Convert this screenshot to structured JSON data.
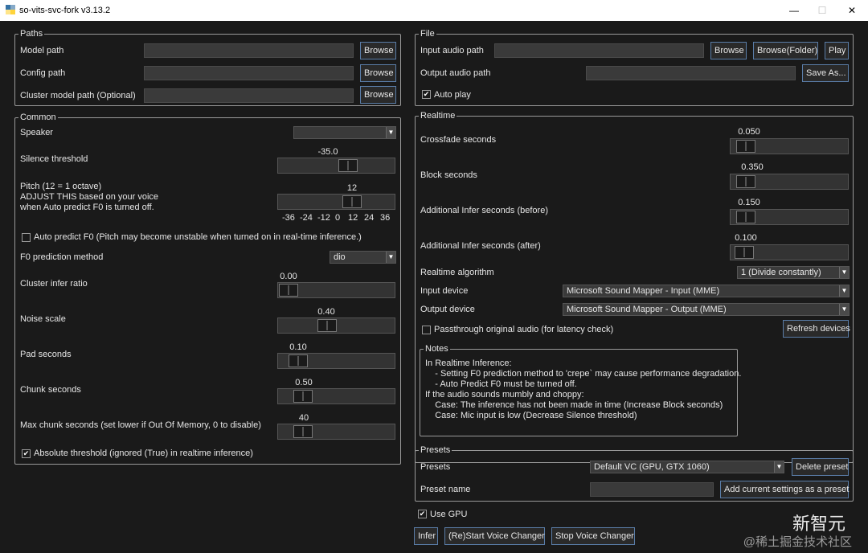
{
  "window": {
    "title": "so-vits-svc-fork v3.13.2",
    "min": "—",
    "max": "☐",
    "close": "✕"
  },
  "paths": {
    "legend": "Paths",
    "model_label": "Model path",
    "config_label": "Config path",
    "cluster_label": "Cluster model path (Optional)",
    "model_value": "",
    "config_value": "",
    "cluster_value": "",
    "browse": "Browse"
  },
  "common": {
    "legend": "Common",
    "speaker_label": "Speaker",
    "speaker_value": "",
    "silence_label": "Silence threshold",
    "silence_value": "-35.0",
    "silence_level": 0.62,
    "pitch_label_1": "Pitch (12 = 1 octave)",
    "pitch_label_2": "ADJUST THIS based on your voice",
    "pitch_label_3": "when Auto predict F0 is turned off.",
    "pitch_value": "12",
    "pitch_level": 0.667,
    "pitch_ticks": [
      "-36",
      "-24",
      "-12",
      "0",
      "12",
      "24",
      "36"
    ],
    "auto_f0_label": "Auto predict F0 (Pitch may become unstable when turned on in real-time inference.)",
    "auto_f0_checked": false,
    "f0_method_label": "F0 prediction method",
    "f0_method_value": "dio",
    "cluster_ratio_label": "Cluster infer ratio",
    "cluster_ratio_value": "0.00",
    "cluster_ratio_level": 0.0,
    "noise_label": "Noise scale",
    "noise_value": "0.40",
    "noise_level": 0.4,
    "pad_label": "Pad seconds",
    "pad_value": "0.10",
    "pad_level": 0.1,
    "chunk_label": "Chunk seconds",
    "chunk_value": "0.50",
    "chunk_level": 0.15,
    "max_chunk_label": "Max chunk seconds (set lower if Out Of Memory, 0 to disable)",
    "max_chunk_value": "40",
    "max_chunk_level": 0.15,
    "abs_threshold_label": "Absolute threshold (ignored (True) in realtime inference)",
    "abs_threshold_checked": true
  },
  "file": {
    "legend": "File",
    "input_label": "Input audio path",
    "output_label": "Output audio path",
    "input_value": "",
    "output_value": "",
    "browse": "Browse",
    "browse_folder": "Browse(Folder)",
    "play": "Play",
    "save_as": "Save As...",
    "auto_play_label": "Auto play",
    "auto_play_checked": true
  },
  "realtime": {
    "legend": "Realtime",
    "crossfade_label": "Crossfade seconds",
    "crossfade_value": "0.050",
    "crossfade_level": 0.05,
    "block_label": "Block seconds",
    "block_value": "0.350",
    "block_level": 0.05,
    "infer_before_label": "Additional Infer seconds (before)",
    "infer_before_value": "0.150",
    "infer_before_level": 0.05,
    "infer_after_label": "Additional Infer seconds (after)",
    "infer_after_value": "0.100",
    "infer_after_level": 0.03,
    "algo_label": "Realtime algorithm",
    "algo_value": "1 (Divide constantly)",
    "input_device_label": "Input device",
    "input_device_value": "Microsoft Sound Mapper - Input (MME)",
    "output_device_label": "Output device",
    "output_device_value": "Microsoft Sound Mapper - Output (MME)",
    "passthrough_label": "Passthrough original audio (for latency check)",
    "passthrough_checked": false,
    "refresh": "Refresh devices"
  },
  "notes": {
    "legend": "Notes",
    "lines": [
      "In Realtime Inference:",
      "    - Setting F0 prediction method to 'crepe` may cause performance degradation.",
      "    - Auto Predict F0 must be turned off.",
      "If the audio sounds mumbly and choppy:",
      "    Case: The inference has not been made in time (Increase Block seconds)",
      "    Case: Mic input is low (Decrease Silence threshold)"
    ]
  },
  "presets": {
    "legend": "Presets",
    "presets_label": "Presets",
    "presets_value": "Default VC (GPU, GTX 1060)",
    "delete": "Delete preset",
    "name_label": "Preset name",
    "name_value": "",
    "add": "Add current settings as a preset"
  },
  "bottom": {
    "use_gpu_label": "Use GPU",
    "use_gpu_checked": true,
    "infer": "Infer",
    "restart": "(Re)Start Voice Changer",
    "stop": "Stop Voice Changer"
  },
  "watermark": {
    "line1": "新智元",
    "line2": "@稀土掘金技术社区"
  },
  "colors": {
    "background": "#1a1a1a",
    "button_border": "#5a7da8",
    "field": "#3a3a3a"
  }
}
